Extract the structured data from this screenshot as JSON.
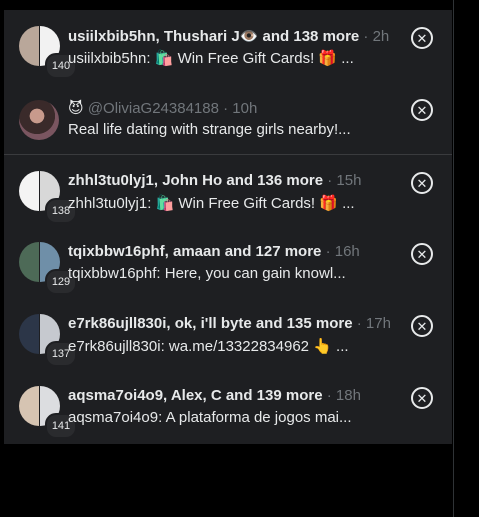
{
  "notifications": [
    {
      "title": "usiilxbib5hn, Thushari J👁️ and 138 more",
      "time": "· 2h",
      "preview": "usiilxbib5hn: 🛍️ Win Free Gift Cards! 🎁 ...",
      "count": "140",
      "avatar_colors": [
        "#b9a79a",
        "#f2f2f2"
      ],
      "close_icon": "close-circle-icon"
    },
    {
      "title": "@OliviaG24384188",
      "time": "· 10h",
      "preview": "Real life dating with strange girls nearby!...",
      "emoji": "😈",
      "close_icon": "close-circle-icon"
    },
    {
      "title": "zhhl3tu0lyj1, John Ho and 136 more",
      "time": "· 15h",
      "preview": "zhhl3tu0lyj1: 🛍️ Win Free Gift Cards! 🎁 ...",
      "count": "138",
      "avatar_colors": [
        "#f4f4f4",
        "#d8d8d8"
      ],
      "close_icon": "close-circle-icon"
    },
    {
      "title": "tqixbbw16phf, amaan and 127 more",
      "time": "· 16h",
      "preview": "tqixbbw16phf: Here, you can gain knowl...",
      "count": "129",
      "avatar_colors": [
        "#4d6a57",
        "#6f8fa8"
      ],
      "close_icon": "close-circle-icon"
    },
    {
      "title": "e7rk86ujll830i, ok, i'll byte and 135 more",
      "time": "· 17h",
      "preview": "e7rk86ujll830i: wa.me/13322834962 👆 ...",
      "count": "137",
      "avatar_colors": [
        "#2c3648",
        "#c6c9cf"
      ],
      "close_icon": "close-circle-icon"
    },
    {
      "title": "aqsma7oi4o9, Alex, C and 139 more",
      "time": "· 18h",
      "preview": "aqsma7oi4o9: A plataforma de jogos mai...",
      "count": "141",
      "avatar_colors": [
        "#d6c4b2",
        "#dcdde0"
      ],
      "close_icon": "close-circle-icon"
    }
  ]
}
